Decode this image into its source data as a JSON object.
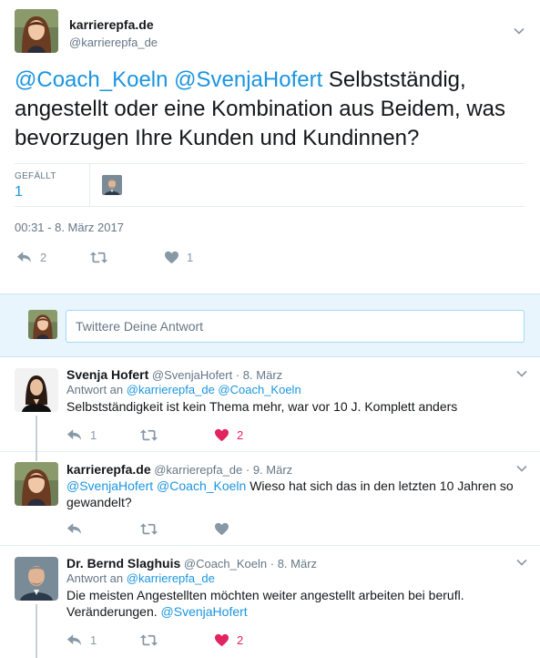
{
  "main_tweet": {
    "name": "karrierepfa.de",
    "handle": "@karrierepfa_de",
    "mention1": "@Coach_Koeln",
    "mention2": "@SvenjaHofert",
    "text": "Selbstständig, angestellt oder eine Kombination aus Beidem, was bevorzugen Ihre Kunden und Kundinnen?",
    "stats": {
      "label": "GEFÄLLT",
      "value": "1"
    },
    "timestamp": "00:31 - 8. März 2017",
    "actions": {
      "reply_count": "2",
      "retweet_count": "",
      "like_count": "1"
    }
  },
  "reply_box": {
    "placeholder": "Twittere Deine Antwort"
  },
  "replies": [
    {
      "name": "Svenja Hofert",
      "handle": "@SvenjaHofert",
      "date": "· 8. März",
      "reply_to_label": "Antwort an",
      "reply_to": "@karrierepfa_de @Coach_Koeln",
      "text": "Selbstständigkeit ist kein Thema mehr, war vor 10 J. Komplett anders",
      "reply_count": "1",
      "like_count": "2"
    },
    {
      "name": "karrierepfa.de",
      "handle": "@karrierepfa_de",
      "date": "· 9. März",
      "mention1": "@SvenjaHofert",
      "mention2": "@Coach_Koeln",
      "text": "Wieso hat sich das in den letzten 10 Jahren so gewandelt?"
    },
    {
      "name": "Dr. Bernd Slaghuis",
      "handle": "@Coach_Koeln",
      "date": "· 8. März",
      "reply_to_label": "Antwort an",
      "reply_to": "@karrierepfa_de",
      "text_line1": "Die meisten Angestellten möchten weiter angestellt arbeiten bei berufl.",
      "text_line2": "Veränderungen.",
      "trailing_mention": "@SvenjaHofert",
      "reply_count": "1",
      "like_count": "2"
    }
  ],
  "colors": {
    "link": "#1b95e0",
    "like": "#e0245e",
    "muted": "#8899a6",
    "reply_bg": "#e8f5fd"
  }
}
